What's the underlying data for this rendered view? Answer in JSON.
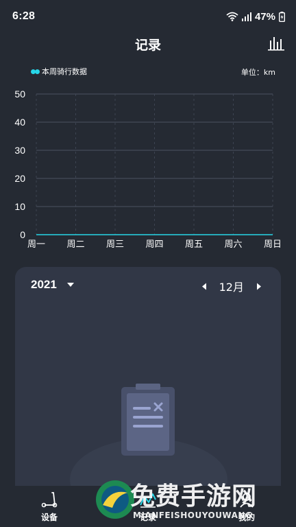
{
  "status_bar": {
    "time": "6:28",
    "battery": "47%"
  },
  "header": {
    "title": "记录"
  },
  "legend": {
    "label": "本周骑行数据"
  },
  "unit_label": "单位：km",
  "chart_data": {
    "type": "line",
    "categories": [
      "周一",
      "周二",
      "周三",
      "周四",
      "周五",
      "周六",
      "周日"
    ],
    "series": [
      {
        "name": "本周骑行数据",
        "values": [
          0,
          0,
          0,
          0,
          0,
          0,
          0
        ]
      }
    ],
    "yticks": [
      "0",
      "10",
      "20",
      "30",
      "40",
      "50"
    ],
    "ylim": [
      0,
      50
    ],
    "grid": true,
    "legend_position": "top-left",
    "series_color": "#27d6e8"
  },
  "calendar": {
    "year": "2021",
    "month": "12月"
  },
  "tabs": [
    {
      "label": "设备",
      "icon": "scooter-icon"
    },
    {
      "label": "记录",
      "icon": "chart-line-icon"
    },
    {
      "label": "我的",
      "icon": "profile-icon"
    }
  ],
  "watermark": {
    "text": "免费手游网",
    "sub": "MIANFEISHOUYOUWANG"
  },
  "colors": {
    "background": "#252a33",
    "card": "#313746",
    "accent": "#27d6e8",
    "grid": "#4a5160"
  }
}
